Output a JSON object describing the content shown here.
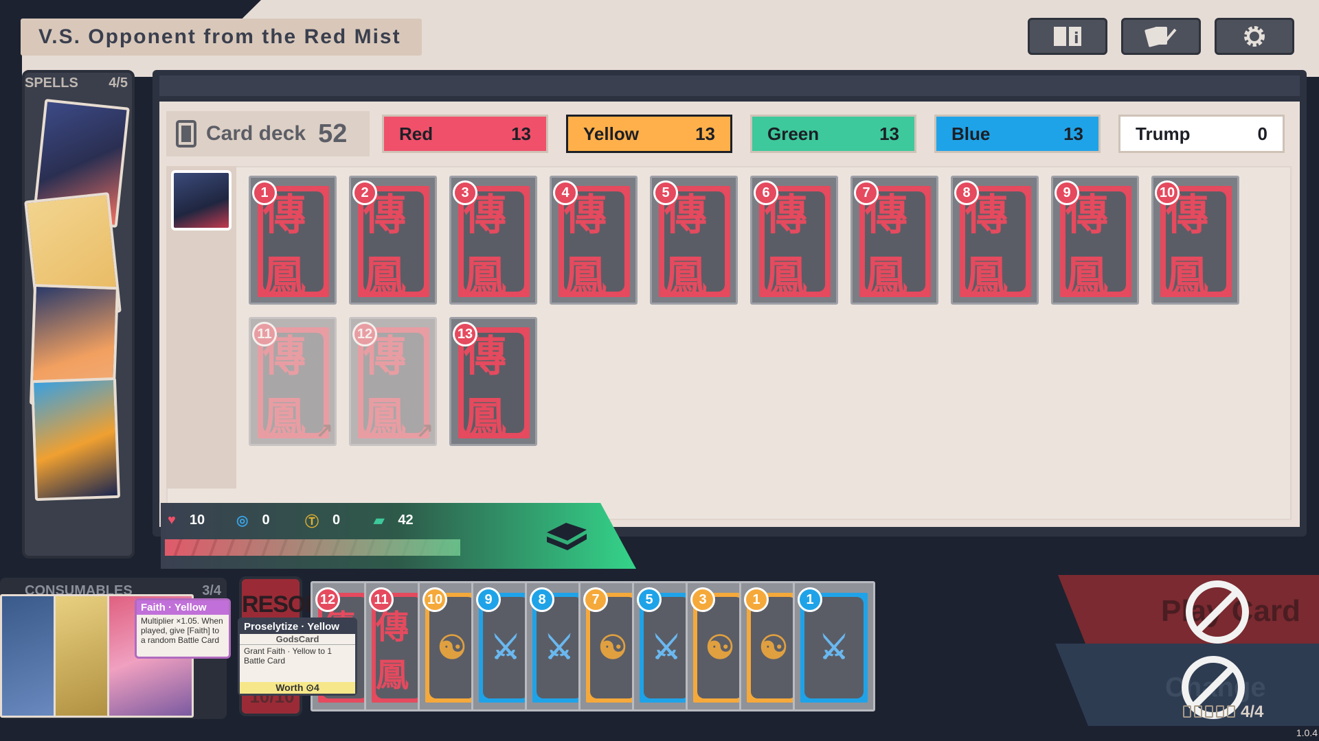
{
  "header": {
    "title": "V.S. Opponent from the Red Mist"
  },
  "spells": {
    "label": "SPELLS",
    "count": "4/5"
  },
  "deck": {
    "label": "Card deck",
    "count": "52"
  },
  "suits": [
    {
      "name": "Red",
      "count": "13",
      "color": "#f0506a",
      "selected": false
    },
    {
      "name": "Yellow",
      "count": "13",
      "color": "#ffb04a",
      "selected": true
    },
    {
      "name": "Green",
      "count": "13",
      "color": "#3dc99b",
      "selected": false
    },
    {
      "name": "Blue",
      "count": "13",
      "color": "#1fa3e8",
      "selected": false
    },
    {
      "name": "Trump",
      "count": "0",
      "color": "#ffffff",
      "selected": false
    }
  ],
  "deck_cards": [
    {
      "num": "1"
    },
    {
      "num": "2"
    },
    {
      "num": "3"
    },
    {
      "num": "4"
    },
    {
      "num": "5"
    },
    {
      "num": "6"
    },
    {
      "num": "7"
    },
    {
      "num": "8"
    },
    {
      "num": "9"
    },
    {
      "num": "10"
    },
    {
      "num": "11",
      "faded": true
    },
    {
      "num": "12",
      "faded": true
    },
    {
      "num": "13"
    }
  ],
  "card_glyph": "傳鳳",
  "status": {
    "hp": "10",
    "shield": "0",
    "gold": "0",
    "cards": "42"
  },
  "consumables": {
    "label": "CONSUMABLES",
    "count": "3/4"
  },
  "consumable_tip": {
    "title": "Faith · Yellow",
    "body": "Multiplier ×1.05. When played, give [Faith] to a random Battle Card"
  },
  "resort": {
    "label": "RESORT",
    "count": "10/10"
  },
  "hand_tip": {
    "title": "Proselytize · Yellow",
    "subtitle": "GodsCard",
    "body": "Grant Faith · Yellow to 1 Battle Card",
    "worth": "Worth ⊙4"
  },
  "hand": [
    {
      "num": "12",
      "suit": "red"
    },
    {
      "num": "11",
      "suit": "red"
    },
    {
      "num": "10",
      "suit": "yellow"
    },
    {
      "num": "9",
      "suit": "blue"
    },
    {
      "num": "8",
      "suit": "blue"
    },
    {
      "num": "7",
      "suit": "yellow"
    },
    {
      "num": "5",
      "suit": "blue"
    },
    {
      "num": "3",
      "suit": "yellow"
    },
    {
      "num": "1",
      "suit": "yellow"
    },
    {
      "num": "1",
      "suit": "blue"
    }
  ],
  "actions": {
    "play": "Play Card",
    "change": "Change",
    "change_count": "4/4"
  },
  "version": "1.0.4",
  "icons": [
    "book-info-icon",
    "cards-check-icon",
    "gear-icon",
    "heart-icon",
    "shield-icon",
    "coin-icon",
    "card-stack-icon",
    "deck-icon",
    "ban-icon"
  ]
}
